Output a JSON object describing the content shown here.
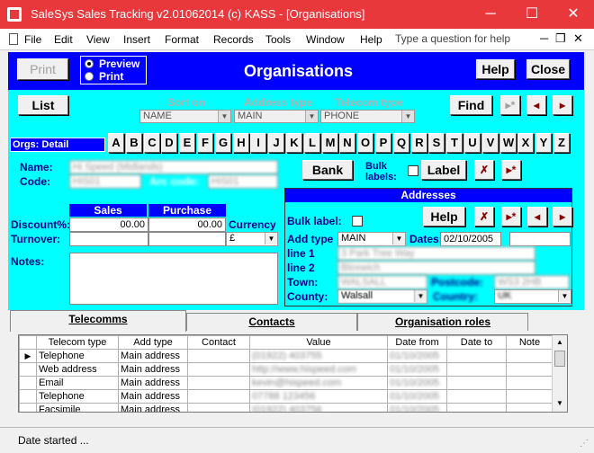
{
  "window": {
    "title": "SaleSys Sales Tracking v2.01062014 (c) KASS - [Organisations]",
    "min": "─",
    "max": "☐",
    "close": "✕"
  },
  "menu": {
    "items": [
      "File",
      "Edit",
      "View",
      "Insert",
      "Format",
      "Records",
      "Tools",
      "Window",
      "Help"
    ],
    "ask_placeholder": "Type a question for help",
    "mdi_close": "✕",
    "mdi_restore": "❐",
    "mdi_min": "─"
  },
  "header": {
    "print": "Print",
    "preview": "Preview",
    "print_radio": "Print",
    "title": "Organisations",
    "help": "Help",
    "close": "Close"
  },
  "toolbar": {
    "list": "List",
    "sort_on_label": "Sort on",
    "sort_on_value": "NAME",
    "address_type_label": "Address type",
    "address_type_value": "MAIN",
    "telecom_type_label": "Telecom type",
    "telecom_type_value": "PHONE",
    "find": "Find",
    "new_glyph": "▸*",
    "prev_glyph": "◂",
    "next_glyph": "▸"
  },
  "detail_label": "Orgs: Detail",
  "letters": [
    "A",
    "B",
    "C",
    "D",
    "E",
    "F",
    "G",
    "H",
    "I",
    "J",
    "K",
    "L",
    "M",
    "N",
    "O",
    "P",
    "Q",
    "R",
    "S",
    "T",
    "U",
    "V",
    "W",
    "X",
    "Y",
    "Z"
  ],
  "org": {
    "name_label": "Name:",
    "name_value": "Hi Speed (Midlands)",
    "code_label": "Code:",
    "code_value": "HIS01",
    "arc_code_label": "Arc code:",
    "arc_code_value": "HIS01",
    "bank": "Bank",
    "bulk_labels": "Bulk\nlabels:",
    "label_btn": "Label",
    "delete_glyph": "✗",
    "new_glyph": "▸*"
  },
  "sales": {
    "sales_head": "Sales",
    "purchase_head": "Purchase",
    "currency_head": "Currency",
    "discount_label": "Discount%:",
    "sales_discount": "00.00",
    "purchase_discount": "00.00",
    "turnover_label": "Turnover:",
    "currency_value": "£",
    "notes_label": "Notes:"
  },
  "addresses": {
    "title": "Addresses",
    "bulk_label": "Bulk label:",
    "help": "Help",
    "add_type_label": "Add type",
    "add_type_value": "MAIN",
    "dates_label": "Dates:",
    "date_value": "02/10/2005",
    "line1_label": "line 1",
    "line1_value": "3 Park Tree Way",
    "line2_label": "line 2",
    "line2_value": "Bloxwich",
    "town_label": "Town:",
    "town_value": "WALSALL",
    "postcode_label": "Postcode:",
    "postcode_value": "WS3 2HB",
    "county_label": "County:",
    "county_value": "Walsall",
    "country_label": "Country:",
    "country_value": "UK"
  },
  "tabs": [
    "Telecomms",
    "Contacts",
    "Organisation roles"
  ],
  "telecomms": {
    "columns": [
      "Telecom type",
      "Add type",
      "Contact",
      "Value",
      "Date from",
      "Date to",
      "Note"
    ],
    "rows": [
      {
        "marker": "▶",
        "type": "Telephone",
        "add": "Main address",
        "contact": "",
        "value": "(01922) 403755",
        "from": "01/10/2005",
        "to": "",
        "note": ""
      },
      {
        "marker": "",
        "type": "Web address",
        "add": "Main address",
        "contact": "",
        "value": "http://www.hispeed.com",
        "from": "01/10/2005",
        "to": "",
        "note": ""
      },
      {
        "marker": "",
        "type": "Email",
        "add": "Main address",
        "contact": "",
        "value": "kevin@hispeed.com",
        "from": "01/10/2005",
        "to": "",
        "note": ""
      },
      {
        "marker": "",
        "type": "Telephone",
        "add": "Main address",
        "contact": "",
        "value": "07788 123456",
        "from": "01/10/2005",
        "to": "",
        "note": ""
      },
      {
        "marker": "",
        "type": "Facsimile",
        "add": "Main address",
        "contact": "",
        "value": "(01922) 403756",
        "from": "01/10/2005",
        "to": "",
        "note": ""
      }
    ]
  },
  "status": {
    "text": "Date started ...",
    "grip": "⋰"
  }
}
